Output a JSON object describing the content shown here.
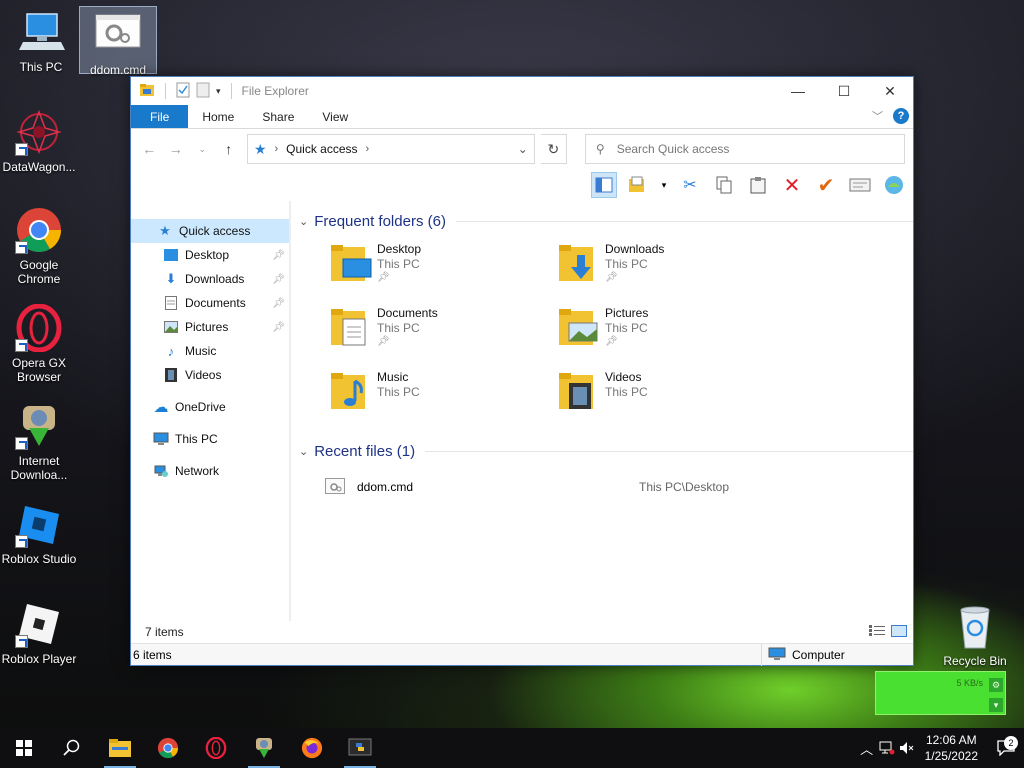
{
  "desktop": {
    "icons": [
      {
        "label": "This PC"
      },
      {
        "label": "ddom.cmd"
      },
      {
        "label": "DataWagon..."
      },
      {
        "label": "Google Chrome"
      },
      {
        "label": "Opera GX Browser"
      },
      {
        "label": "Internet Downloa..."
      },
      {
        "label": "Roblox Studio"
      },
      {
        "label": "Roblox Player"
      },
      {
        "label": "Recycle Bin"
      }
    ]
  },
  "window": {
    "title": "File Explorer",
    "ribbon_tabs": [
      "File",
      "Home",
      "Share",
      "View"
    ],
    "address": {
      "crumb": "Quick access"
    },
    "search": {
      "placeholder": "Search Quick access"
    }
  },
  "nav": {
    "quick_access": "Quick access",
    "pinned": [
      "Desktop",
      "Downloads",
      "Documents",
      "Pictures"
    ],
    "unpinned": [
      "Music",
      "Videos"
    ],
    "onedrive": "OneDrive",
    "this_pc": "This PC",
    "network": "Network"
  },
  "frequent": {
    "header": "Frequent folders (6)",
    "folders": [
      {
        "name": "Desktop",
        "location": "This PC"
      },
      {
        "name": "Downloads",
        "location": "This PC"
      },
      {
        "name": "Documents",
        "location": "This PC"
      },
      {
        "name": "Pictures",
        "location": "This PC"
      },
      {
        "name": "Music",
        "location": "This PC"
      },
      {
        "name": "Videos",
        "location": "This PC"
      }
    ]
  },
  "recent": {
    "header": "Recent files (1)",
    "files": [
      {
        "name": "ddom.cmd",
        "path": "This PC\\Desktop"
      }
    ]
  },
  "status": {
    "items": "7 items",
    "items2": "6 items",
    "zone": "Computer"
  },
  "widget": {
    "text": "5 KB/s"
  },
  "taskbar": {
    "time": "12:06 AM",
    "date": "1/25/2022",
    "notifications": "2"
  },
  "colors": {
    "accent": "#1979ca",
    "selection": "#cce8ff",
    "group_header": "#1e3287",
    "widget_green": "#4ae031"
  }
}
